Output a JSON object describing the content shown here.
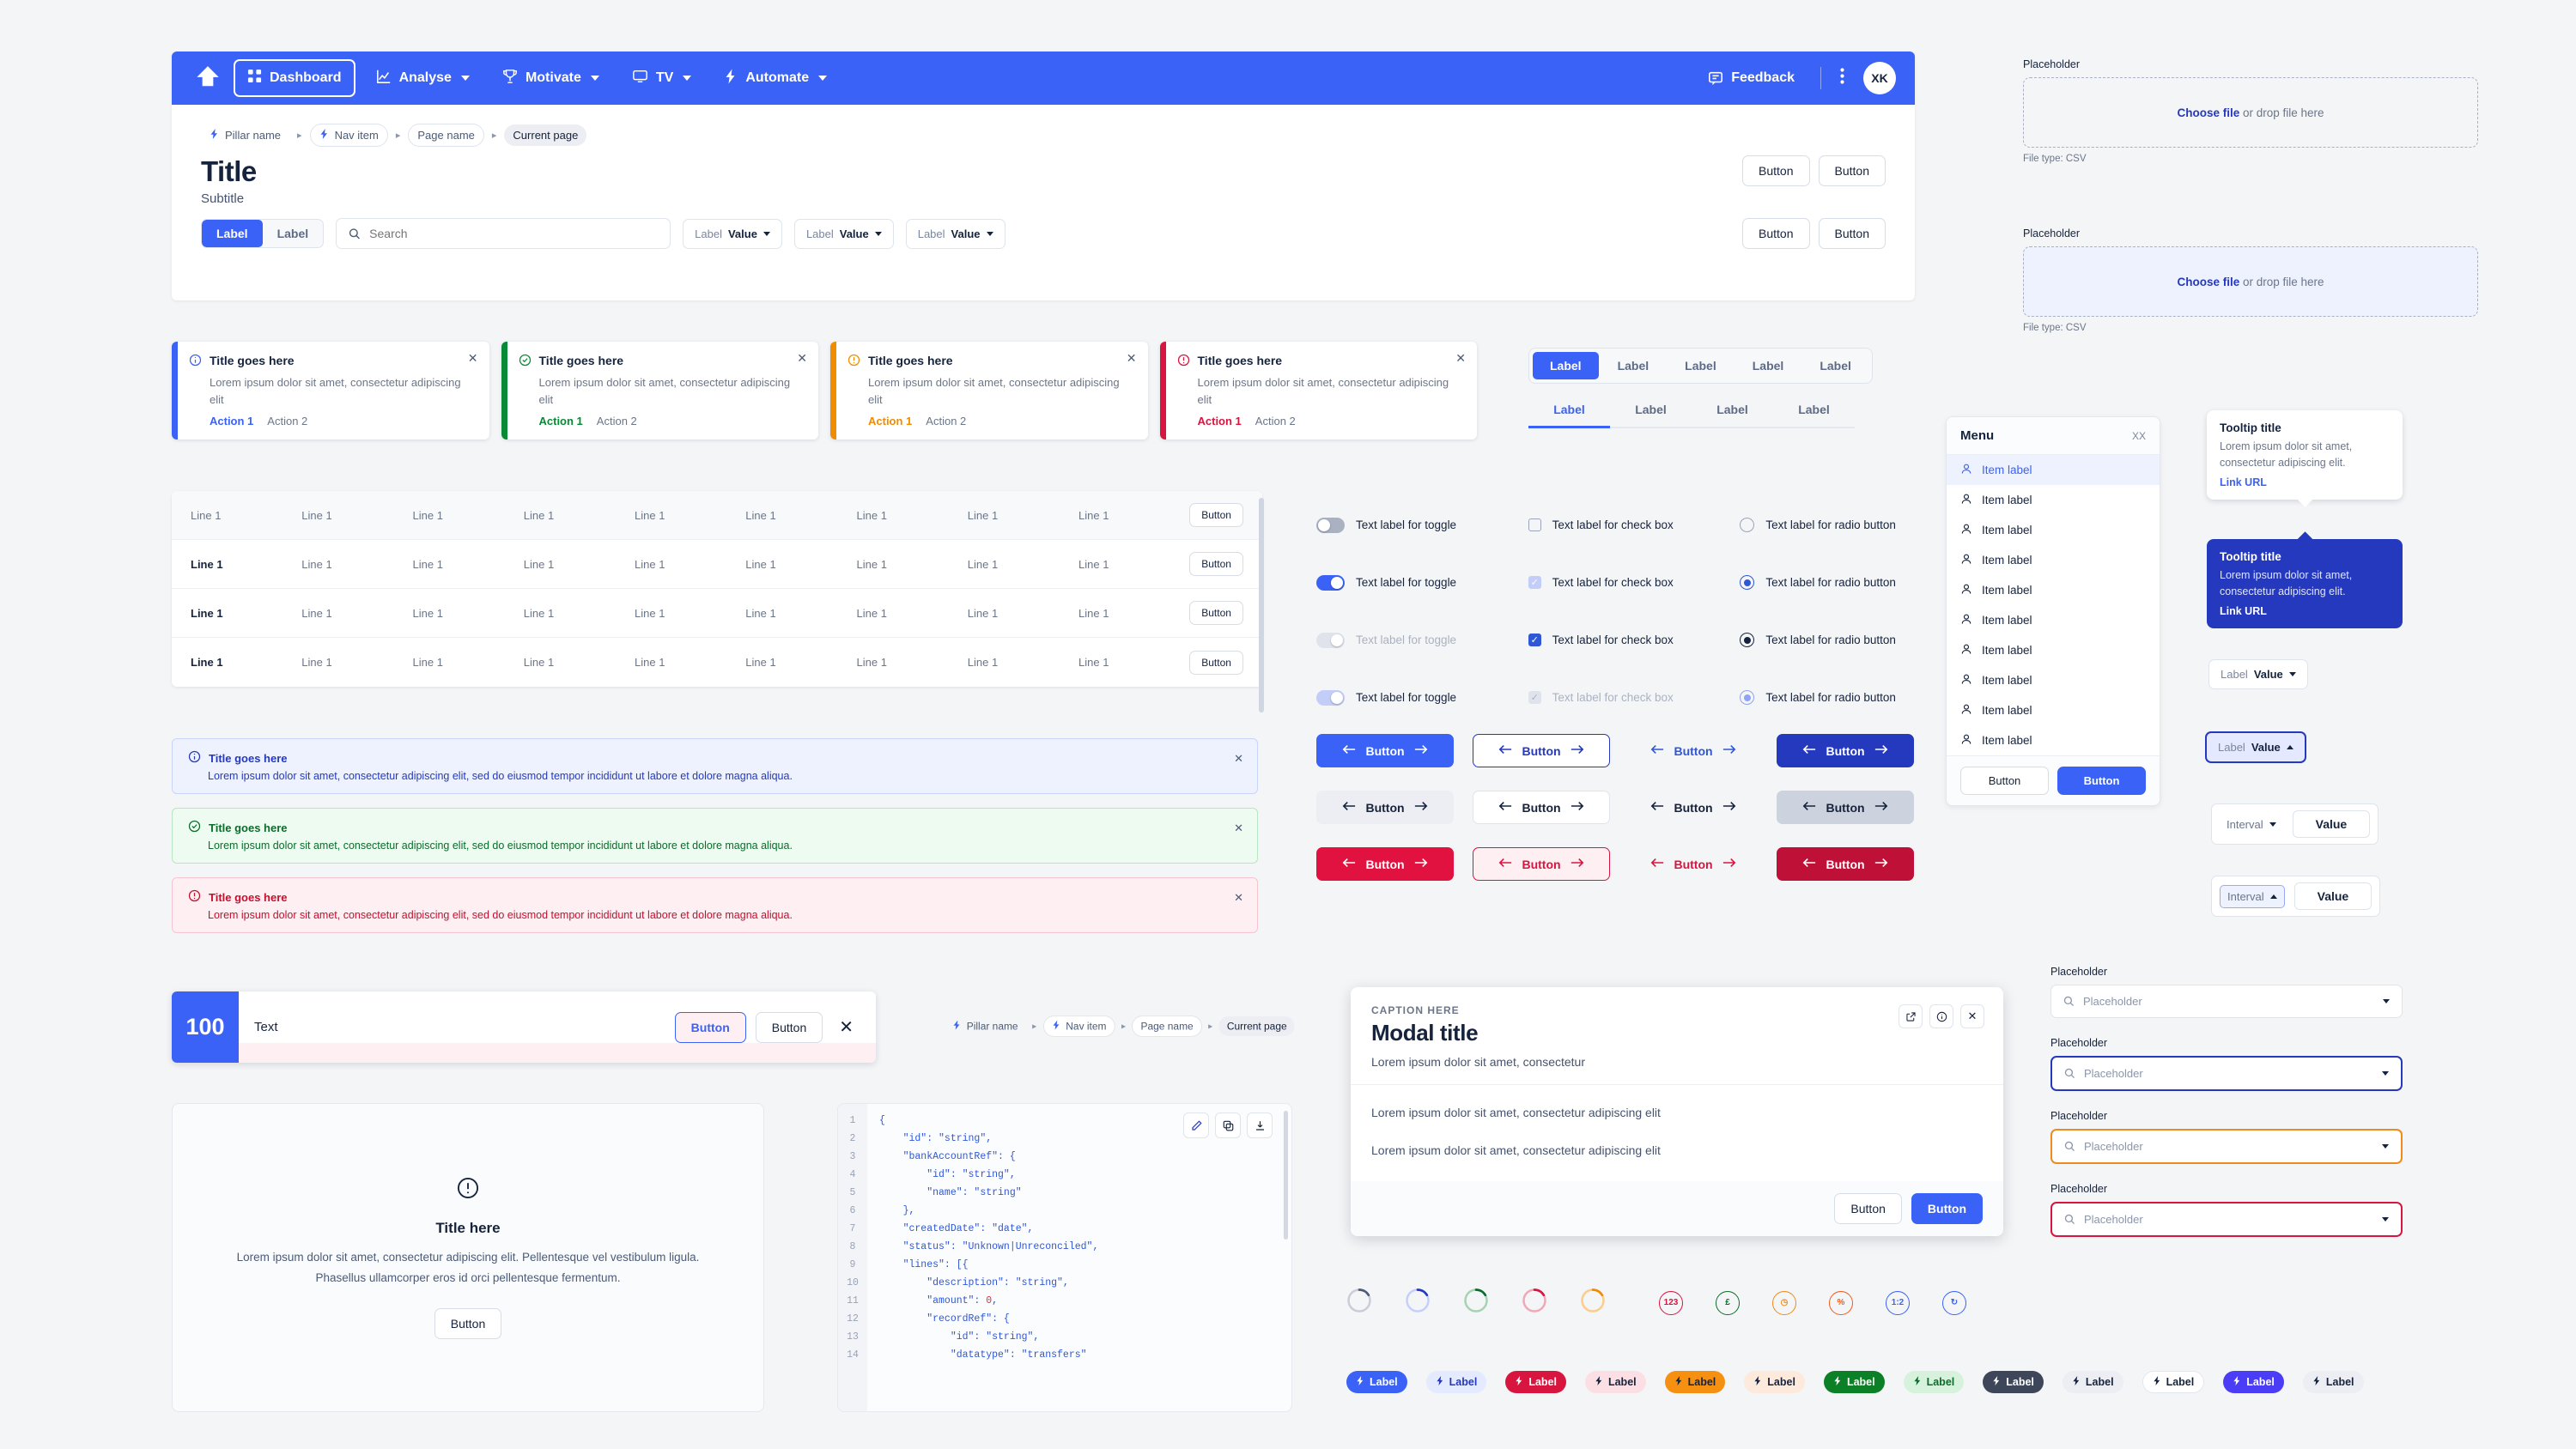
{
  "nav": {
    "logo_icon": "arrow-up-logo-icon",
    "items": [
      {
        "label": "Dashboard",
        "icon": "grid-icon",
        "active": true,
        "caret": false
      },
      {
        "label": "Analyse",
        "icon": "chart-line-icon",
        "active": false,
        "caret": true
      },
      {
        "label": "Motivate",
        "icon": "trophy-icon",
        "active": false,
        "caret": true
      },
      {
        "label": "TV",
        "icon": "monitor-icon",
        "active": false,
        "caret": true
      },
      {
        "label": "Automate",
        "icon": "bolt-icon",
        "active": false,
        "caret": true
      }
    ],
    "feedback_label": "Feedback",
    "feedback_icon": "chat-icon",
    "more_icon": "kebab-menu-icon",
    "avatar_initials": "XK"
  },
  "breadcrumb": {
    "items": [
      {
        "label": "Pillar name",
        "icon": "bolt-icon",
        "style": "plain"
      },
      {
        "label": "Nav item",
        "icon": "bolt-icon",
        "style": "box"
      },
      {
        "label": "Page name",
        "icon": "",
        "style": "box"
      },
      {
        "label": "Current page",
        "icon": "",
        "style": "current"
      }
    ],
    "separator": "▸"
  },
  "header": {
    "title": "Title",
    "subtitle": "Subtitle",
    "buttons": [
      "Button",
      "Button"
    ]
  },
  "filters": {
    "segments": [
      {
        "label": "Label",
        "on": true
      },
      {
        "label": "Label",
        "on": false
      }
    ],
    "search_placeholder": "Search",
    "search_icon": "search-icon",
    "selects": [
      {
        "label": "Label",
        "value": "Value"
      },
      {
        "label": "Label",
        "value": "Value"
      },
      {
        "label": "Label",
        "value": "Value"
      }
    ],
    "buttons": [
      "Button",
      "Button"
    ]
  },
  "toasts": [
    {
      "title": "Title goes here",
      "body": "Lorem ipsum dolor sit amet, consectetur adipiscing elit",
      "action1": "Action 1",
      "action2": "Action 2",
      "color": "#3b62f6",
      "icon": "info-circle-icon"
    },
    {
      "title": "Title goes here",
      "body": "Lorem ipsum dolor sit amet, consectetur adipiscing elit",
      "action1": "Action 1",
      "action2": "Action 2",
      "color": "#068a35",
      "icon": "check-circle-icon"
    },
    {
      "title": "Title goes here",
      "body": "Lorem ipsum dolor sit amet, consectetur adipiscing elit",
      "action1": "Action 1",
      "action2": "Action 2",
      "color": "#f08c00",
      "icon": "warning-circle-icon"
    },
    {
      "title": "Title goes here",
      "body": "Lorem ipsum dolor sit amet, consectetur adipiscing elit",
      "action1": "Action 1",
      "action2": "Action 2",
      "color": "#d8153f",
      "icon": "error-circle-icon"
    }
  ],
  "table": {
    "header": [
      "Line 1",
      "Line 1",
      "Line 1",
      "Line 1",
      "Line 1",
      "Line 1",
      "Line 1",
      "Line 1",
      "Line 1"
    ],
    "header_action": "Button",
    "rows": [
      {
        "cells": [
          "Line 1",
          "Line 1",
          "Line 1",
          "Line 1",
          "Line 1",
          "Line 1",
          "Line 1",
          "Line 1",
          "Line 1"
        ],
        "action": "Button"
      },
      {
        "cells": [
          "Line 1",
          "Line 1",
          "Line 1",
          "Line 1",
          "Line 1",
          "Line 1",
          "Line 1",
          "Line 1",
          "Line 1"
        ],
        "action": "Button"
      },
      {
        "cells": [
          "Line 1",
          "Line 1",
          "Line 1",
          "Line 1",
          "Line 1",
          "Line 1",
          "Line 1",
          "Line 1",
          "Line 1"
        ],
        "action": "Button"
      }
    ]
  },
  "banners": [
    {
      "title": "Title goes here",
      "body": "Lorem ipsum dolor sit amet, consectetur adipiscing elit, sed do eiusmod tempor incididunt ut labore et dolore magna aliqua.",
      "bg": "#eef2ff",
      "border": "#c9d4fb",
      "fg": "#2439bd",
      "icon": "info-circle-icon"
    },
    {
      "title": "Title goes here",
      "body": "Lorem ipsum dolor sit amet, consectetur adipiscing elit, sed do eiusmod tempor incididunt ut labore et dolore magna aliqua.",
      "bg": "#eefbf0",
      "border": "#b7e6c2",
      "fg": "#0b6c2c",
      "icon": "check-circle-icon"
    },
    {
      "title": "Title goes here",
      "body": "Lorem ipsum dolor sit amet, consectetur adipiscing elit, sed do eiusmod tempor incididunt ut labore et dolore magna aliqua.",
      "bg": "#fdeff2",
      "border": "#f6c4d0",
      "fg": "#c4102f",
      "icon": "error-circle-icon"
    }
  ],
  "snackbar": {
    "count": "100",
    "text": "Text",
    "button1": "Button",
    "button2": "Button",
    "close_icon": "close-icon"
  },
  "empty_state": {
    "icon": "alert-circle-icon",
    "title": "Title here",
    "body": "Lorem ipsum dolor sit amet, consectetur adipiscing elit. Pellentesque vel vestibulum ligula. Phasellus ullamcorper eros id orci pellentesque fermentum.",
    "button": "Button"
  },
  "code": {
    "tools": [
      "edit-icon",
      "copy-icon",
      "download-icon"
    ],
    "lines": [
      {
        "n": "1",
        "src": "{"
      },
      {
        "n": "2",
        "src": "    \"id\": \"string\","
      },
      {
        "n": "3",
        "src": "    \"bankAccountRef\": {"
      },
      {
        "n": "4",
        "src": "        \"id\": \"string\","
      },
      {
        "n": "5",
        "src": "        \"name\": \"string\""
      },
      {
        "n": "6",
        "src": "    },"
      },
      {
        "n": "7",
        "src": "    \"createdDate\": \"date\","
      },
      {
        "n": "8",
        "src": "    \"status\": \"Unknown|Unreconciled\","
      },
      {
        "n": "9",
        "src": "    \"lines\": [{"
      },
      {
        "n": "10",
        "src": "        \"description\": \"string\","
      },
      {
        "n": "11",
        "src": "        \"amount\": 0,"
      },
      {
        "n": "12",
        "src": "        \"recordRef\": {"
      },
      {
        "n": "13",
        "src": "            \"id\": \"string\","
      },
      {
        "n": "14",
        "src": "            \"datatype\": \"transfers\""
      }
    ]
  },
  "tabs": {
    "pills": [
      {
        "label": "Label",
        "on": true
      },
      {
        "label": "Label",
        "on": false
      },
      {
        "label": "Label",
        "on": false
      },
      {
        "label": "Label",
        "on": false
      },
      {
        "label": "Label",
        "on": false
      }
    ],
    "underline": [
      {
        "label": "Label",
        "on": true
      },
      {
        "label": "Label",
        "on": false
      },
      {
        "label": "Label",
        "on": false
      },
      {
        "label": "Label",
        "on": false
      }
    ]
  },
  "controls": {
    "rows": [
      {
        "toggle": {
          "label": "Text label for toggle",
          "state": "off"
        },
        "check": {
          "label": "Text label for check box",
          "state": "unchecked"
        },
        "radio": {
          "label": "Text label for radio button",
          "state": "unselected"
        }
      },
      {
        "toggle": {
          "label": "Text label for toggle",
          "state": "on"
        },
        "check": {
          "label": "Text label for check box",
          "state": "checked-light"
        },
        "radio": {
          "label": "Text label for radio button",
          "state": "selected"
        }
      },
      {
        "toggle": {
          "label": "Text label for toggle",
          "state": "disabled"
        },
        "check": {
          "label": "Text label for check box",
          "state": "checked"
        },
        "radio": {
          "label": "Text label for radio button",
          "state": "selected-dark"
        }
      },
      {
        "toggle": {
          "label": "Text label for toggle",
          "state": "light"
        },
        "check": {
          "label": "Text label for check box",
          "state": "checked-disabled"
        },
        "radio": {
          "label": "Text label for radio button",
          "state": "selected-light"
        }
      }
    ]
  },
  "button_matrix": {
    "left_icon": "arrow-left-icon",
    "right_icon": "arrow-right-icon",
    "rows": [
      [
        {
          "label": "Button",
          "variant": "primary-solid"
        },
        {
          "label": "Button",
          "variant": "primary-outline"
        },
        {
          "label": "Button",
          "variant": "primary-ghost"
        },
        {
          "label": "Button",
          "variant": "primary-dark"
        }
      ],
      [
        {
          "label": "Button",
          "variant": "neutral-solid"
        },
        {
          "label": "Button",
          "variant": "neutral-outline"
        },
        {
          "label": "Button",
          "variant": "neutral-ghost"
        },
        {
          "label": "Button",
          "variant": "neutral-dark"
        }
      ],
      [
        {
          "label": "Button",
          "variant": "danger-solid"
        },
        {
          "label": "Button",
          "variant": "danger-outline"
        },
        {
          "label": "Button",
          "variant": "danger-ghost"
        },
        {
          "label": "Button",
          "variant": "danger-dark"
        }
      ]
    ]
  },
  "menu": {
    "title": "Menu",
    "close_label": "XX",
    "item_icon": "user-icon",
    "items": [
      {
        "label": "Item label",
        "selected": true
      },
      {
        "label": "Item label",
        "selected": false
      },
      {
        "label": "Item label",
        "selected": false
      },
      {
        "label": "Item label",
        "selected": false
      },
      {
        "label": "Item label",
        "selected": false
      },
      {
        "label": "Item label",
        "selected": false
      },
      {
        "label": "Item label",
        "selected": false
      },
      {
        "label": "Item label",
        "selected": false
      },
      {
        "label": "Item label",
        "selected": false
      },
      {
        "label": "Item label",
        "selected": false
      }
    ],
    "buttons": [
      {
        "label": "Button",
        "primary": false
      },
      {
        "label": "Button",
        "primary": true
      }
    ]
  },
  "tooltips": [
    {
      "title": "Tooltip title",
      "body": "Lorem ipsum dolor sit amet, consectetur adipiscing elit.",
      "link": "Link URL",
      "theme": "light"
    },
    {
      "title": "Tooltip title",
      "body": "Lorem ipsum dolor sit amet, consectetur adipiscing elit.",
      "link": "Link URL",
      "theme": "dark"
    }
  ],
  "right_selects": [
    {
      "label": "Label",
      "value": "Value",
      "state": "default",
      "arrow": "down"
    },
    {
      "label": "Label",
      "value": "Value",
      "state": "focused",
      "arrow": "up"
    }
  ],
  "interval_rows": [
    {
      "label": "Interval",
      "value": "Value",
      "state": "default",
      "arrow": "down"
    },
    {
      "label": "Interval",
      "value": "Value",
      "state": "active",
      "arrow": "up"
    }
  ],
  "uploaders": [
    {
      "label": "Placeholder",
      "link": "Choose file",
      "rest": " or drop file here",
      "file_type": "File type: CSV",
      "highlight": false
    },
    {
      "label": "Placeholder",
      "link": "Choose file",
      "rest": " or drop file here",
      "file_type": "File type: CSV",
      "highlight": true
    }
  ],
  "search_dropdowns": [
    {
      "label": "Placeholder",
      "placeholder": "Placeholder",
      "state": "default"
    },
    {
      "label": "Placeholder",
      "placeholder": "Placeholder",
      "state": "blue"
    },
    {
      "label": "Placeholder",
      "placeholder": "Placeholder",
      "state": "orange"
    },
    {
      "label": "Placeholder",
      "placeholder": "Placeholder",
      "state": "red"
    }
  ],
  "modal": {
    "caption": "CAPTION HERE",
    "title": "Modal title",
    "subtitle": "Lorem ipsum dolor sit amet, consectetur",
    "paragraphs": [
      "Lorem ipsum dolor sit amet, consectetur adipiscing elit",
      "Lorem ipsum dolor sit amet, consectetur adipiscing elit"
    ],
    "icons": [
      "external-link-icon",
      "info-circle-icon",
      "close-icon"
    ],
    "buttons": [
      {
        "label": "Button",
        "primary": false
      },
      {
        "label": "Button",
        "primary": true
      }
    ]
  },
  "spinners": [
    {
      "track": "#c8cdd8",
      "arc": "#4b5b78"
    },
    {
      "track": "#c4d0fb",
      "arc": "#2439bd"
    },
    {
      "track": "#a6d3b2",
      "arc": "#0b6c2c"
    },
    {
      "track": "#f0a8b8",
      "arc": "#d8153f"
    },
    {
      "track": "#fbcc8e",
      "arc": "#f08c00"
    }
  ],
  "icon_chips": [
    {
      "glyph": "123",
      "color": "#d8153f",
      "name": "number-icon"
    },
    {
      "glyph": "£",
      "color": "#0b6c2c",
      "name": "currency-icon"
    },
    {
      "glyph": "◷",
      "color": "#ef8a1c",
      "name": "clock-icon"
    },
    {
      "glyph": "%",
      "color": "#ef5b1c",
      "name": "percent-icon"
    },
    {
      "glyph": "1:2",
      "color": "#3b62f6",
      "name": "ratio-icon"
    },
    {
      "glyph": "↻",
      "color": "#3b62f6",
      "name": "refresh-icon"
    }
  ],
  "badges": [
    {
      "label": "Label",
      "bg": "#3b62f6",
      "fg": "#ffffff"
    },
    {
      "label": "Label",
      "bg": "#e4eaff",
      "fg": "#2439bd"
    },
    {
      "label": "Label",
      "bg": "#d8153f",
      "fg": "#ffffff"
    },
    {
      "label": "Label",
      "bg": "#fbdfe5",
      "fg": "#16233c"
    },
    {
      "label": "Label",
      "bg": "#f59010",
      "fg": "#16233c"
    },
    {
      "label": "Label",
      "bg": "#fdeadc",
      "fg": "#16233c"
    },
    {
      "label": "Label",
      "bg": "#0b8026",
      "fg": "#ffffff"
    },
    {
      "label": "Label",
      "bg": "#d7f2dc",
      "fg": "#0b6c2c"
    },
    {
      "label": "Label",
      "bg": "#3d4759",
      "fg": "#ffffff"
    },
    {
      "label": "Label",
      "bg": "#eceef3",
      "fg": "#16233c"
    },
    {
      "label": "Label",
      "bg": "#ffffff",
      "fg": "#16233c"
    },
    {
      "label": "Label",
      "bg": "#4b3df6",
      "fg": "#ffffff"
    },
    {
      "label": "Label",
      "bg": "#eceef3",
      "fg": "#16233c"
    }
  ],
  "colors": {
    "primary": "#3b62f6",
    "dark": "#2439bd",
    "danger": "#d8153f",
    "success": "#0b8026",
    "warning": "#f08c00"
  }
}
